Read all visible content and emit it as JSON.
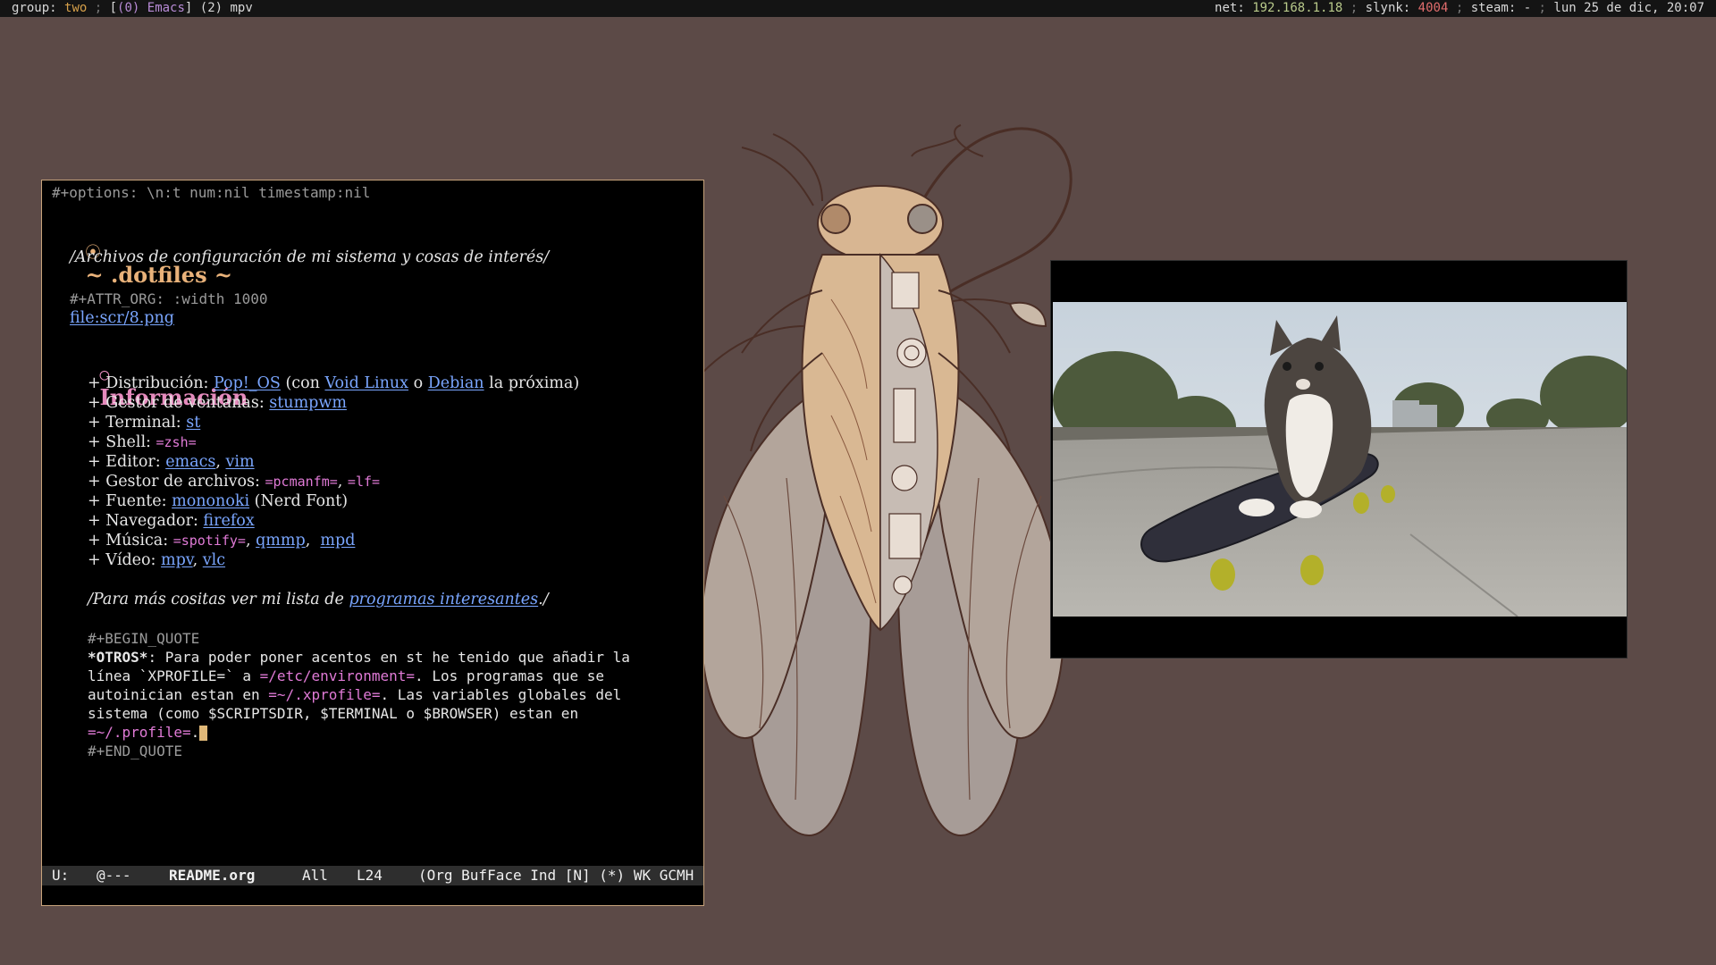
{
  "topbar": {
    "group_label": "group: ",
    "group_name": "two",
    "sep1": " ; ",
    "win_open": "[",
    "win0_index": "(0) ",
    "win0_name": "Emacs",
    "win_close": "] ",
    "win1": "(2) mpv",
    "net_label": "net: ",
    "net_value": "192.168.1.18",
    "sep2": " ; ",
    "slynk_label": "slynk: ",
    "slynk_value": "4004",
    "sep3": " ; ",
    "steam_label": "steam: -",
    "sep4": " ; ",
    "datetime": "lun 25 de dic, 20:07"
  },
  "emacs": {
    "options": "#+options: \\n:t num:nil timestamp:nil",
    "h1_bullet": "⦿",
    "h1": "~ .dotfiles ~",
    "subtitle": "/Archivos de configuración de mi sistema y cosas de interés/",
    "attr": "#+ATTR_ORG: :width 1000",
    "file_link": "file:scr/8.png",
    "h2_bullet": "○",
    "h2": "Información",
    "items": {
      "distro_label": "+ Distribución: ",
      "distro_link": "Pop!_OS",
      "distro_mid1": " (con ",
      "distro_link2": "Void Linux",
      "distro_mid2": " o ",
      "distro_link3": "Debian",
      "distro_end": " la próxima)",
      "wm_label": "+ Gestor de ventanas: ",
      "wm_link": "stumpwm",
      "term_label": "+ Terminal: ",
      "term_link": "st",
      "shell_label": "+ Shell: ",
      "shell_verb": "=zsh=",
      "editor_label": "+ Editor: ",
      "editor_link1": "emacs",
      "editor_sep": ", ",
      "editor_link2": "vim",
      "files_label": "+ Gestor de archivos: ",
      "files_verb1": "=pcmanfm=",
      "files_sep": ", ",
      "files_verb2": "=lf=",
      "font_label": "+ Fuente: ",
      "font_link": "mononoki",
      "font_end": " (Nerd Font)",
      "browser_label": "+ Navegador: ",
      "browser_link": "firefox",
      "music_label": "+ Música: ",
      "music_verb": "=spotify=",
      "music_sep1": ", ",
      "music_link1": "qmmp",
      "music_sep2": ",  ",
      "music_link2": "mpd",
      "video_label": "+ Vídeo: ",
      "video_link1": "mpv",
      "video_sep": ", ",
      "video_link2": "vlc"
    },
    "more_pre": "/Para más cositas ver mi lista de ",
    "more_link": "programas interesantes",
    "more_post": "./",
    "begin_quote": "#+BEGIN_QUOTE",
    "q1_bold": "*OTROS*",
    "q1_rest": ": Para poder poner acentos en st he tenido que añadir la",
    "q2_pre": "línea `XPROFILE=` a ",
    "q2_verb": "=/etc/environment=",
    "q2_post": ". Los programas que se",
    "q3_pre": "autoinician estan en ",
    "q3_verb": "=~/.xprofile=",
    "q3_post": ". Las variables globales del",
    "q4": "sistema (como $SCRIPTSDIR, $TERMINAL o $BROWSER) estan en",
    "q5_verb": "=~/.profile=",
    "q5_post": ".",
    "end_quote": "#+END_QUOTE",
    "modeline": {
      "state": "U:",
      "flags": "@---",
      "buffer": "README.org",
      "position": "All",
      "line": "L24",
      "modes": "(Org BufFace Ind [N] (*) WK GCMH"
    }
  },
  "mpv": {
    "title": "mpv"
  },
  "colors": {
    "desktop": "#5c4a47",
    "heading1": "#e9b27a",
    "heading2": "#e58bbd",
    "link": "#7aa6ff",
    "verbatim": "#e07ad6"
  }
}
